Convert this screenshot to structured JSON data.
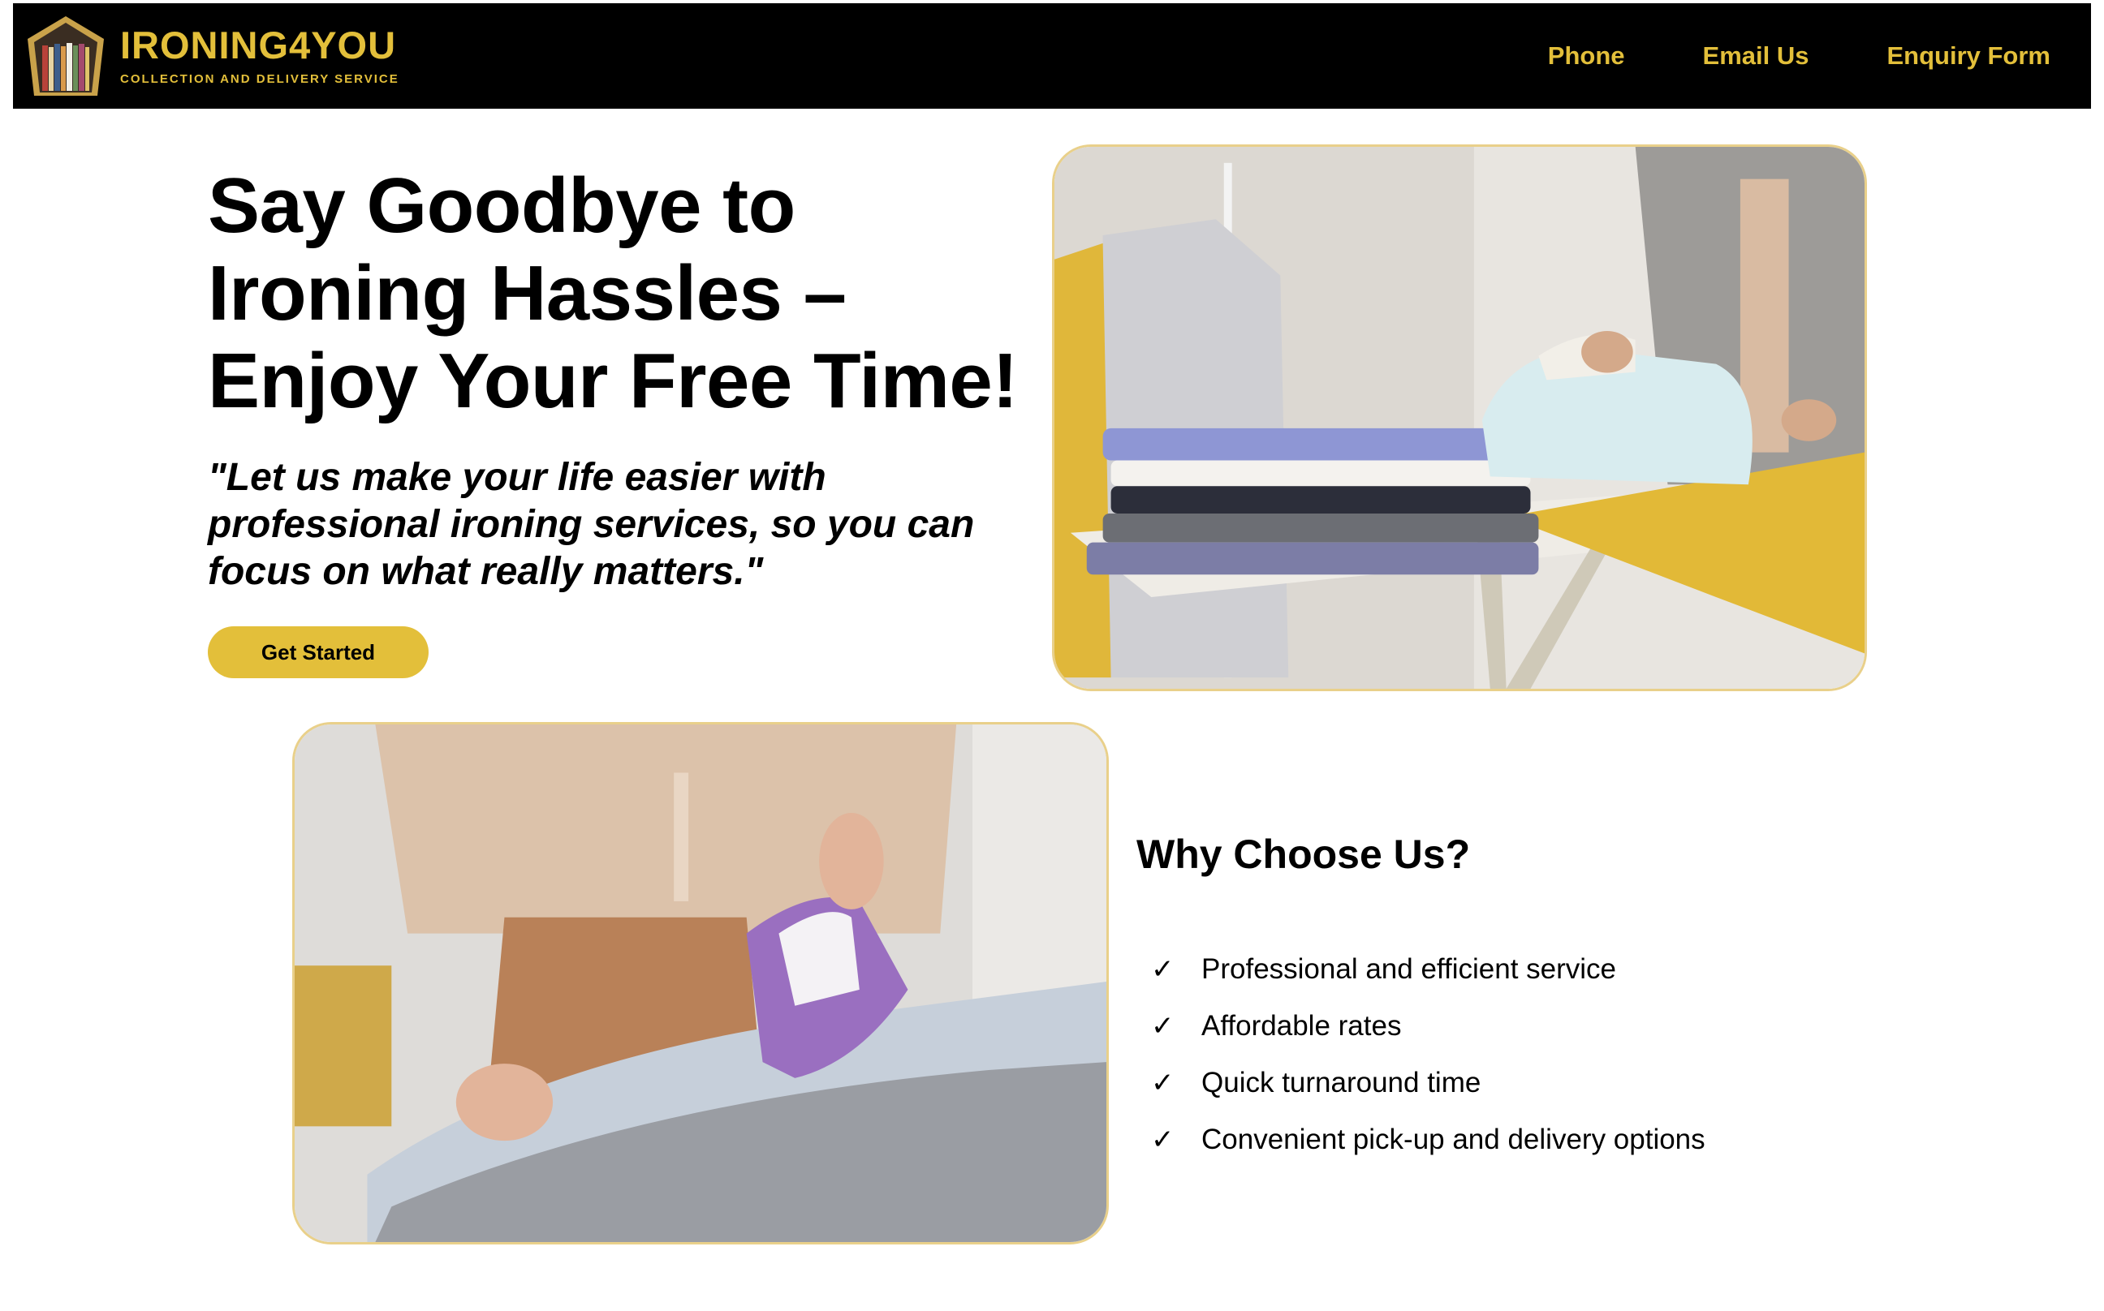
{
  "brand": {
    "name": "IRONING4YOU",
    "tagline": "COLLECTION AND DELIVERY SERVICE",
    "accent_color": "#e3bf3a",
    "logo_icon": "house-wardrobe-logo"
  },
  "nav": {
    "items": [
      {
        "label": "Phone"
      },
      {
        "label": "Email Us"
      },
      {
        "label": "Enquiry Form"
      }
    ]
  },
  "hero": {
    "title": "Say Goodbye to Ironing Hassles – Enjoy Your Free Time!",
    "quote": "\"Let us make your life easier with professional ironing services, so you can focus on what really matters.\"",
    "cta_label": "Get Started"
  },
  "why": {
    "title": "Why Choose Us?",
    "check_icon": "checkmark-icon",
    "check_glyph": "✓",
    "items": [
      "Professional and efficient service",
      "Affordable rates",
      "Quick turnaround time",
      "Convenient pick-up and delivery options"
    ]
  }
}
